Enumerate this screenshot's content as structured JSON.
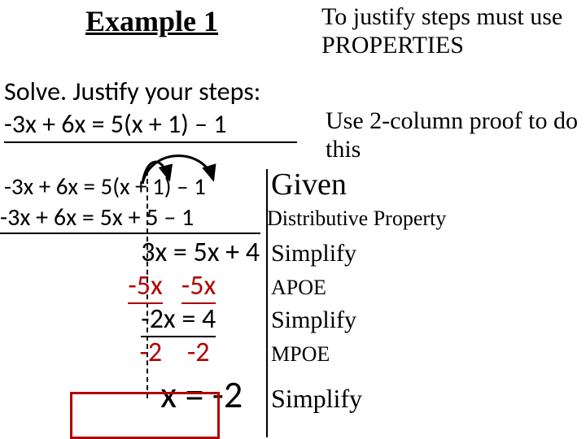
{
  "title": "Example 1",
  "note_justify": "To justify steps must use PROPERTIES",
  "note_use": "Use 2-column proof to do this",
  "instruction": "Solve. Justify your steps:",
  "problem": "-3x + 6x = 5(x + 1) – 1",
  "proof": {
    "r1": {
      "step": "-3x + 6x = 5(x + 1) – 1",
      "reason": "Given"
    },
    "r2": {
      "step": "-3x + 6x = 5x + 5 – 1",
      "reason": "Distributive Property"
    },
    "r3": {
      "step": "3x = 5x + 4",
      "reason": "Simplify"
    },
    "r4": {
      "step_a": "-5x",
      "step_b": "-5x",
      "reason": "APOE"
    },
    "r5": {
      "step": "-2x = 4",
      "reason": "Simplify"
    },
    "r6": {
      "step_a": "-2",
      "step_b": "-2",
      "reason": "MPOE"
    },
    "r7": {
      "step": "x = -2",
      "reason": "Simplify"
    }
  }
}
